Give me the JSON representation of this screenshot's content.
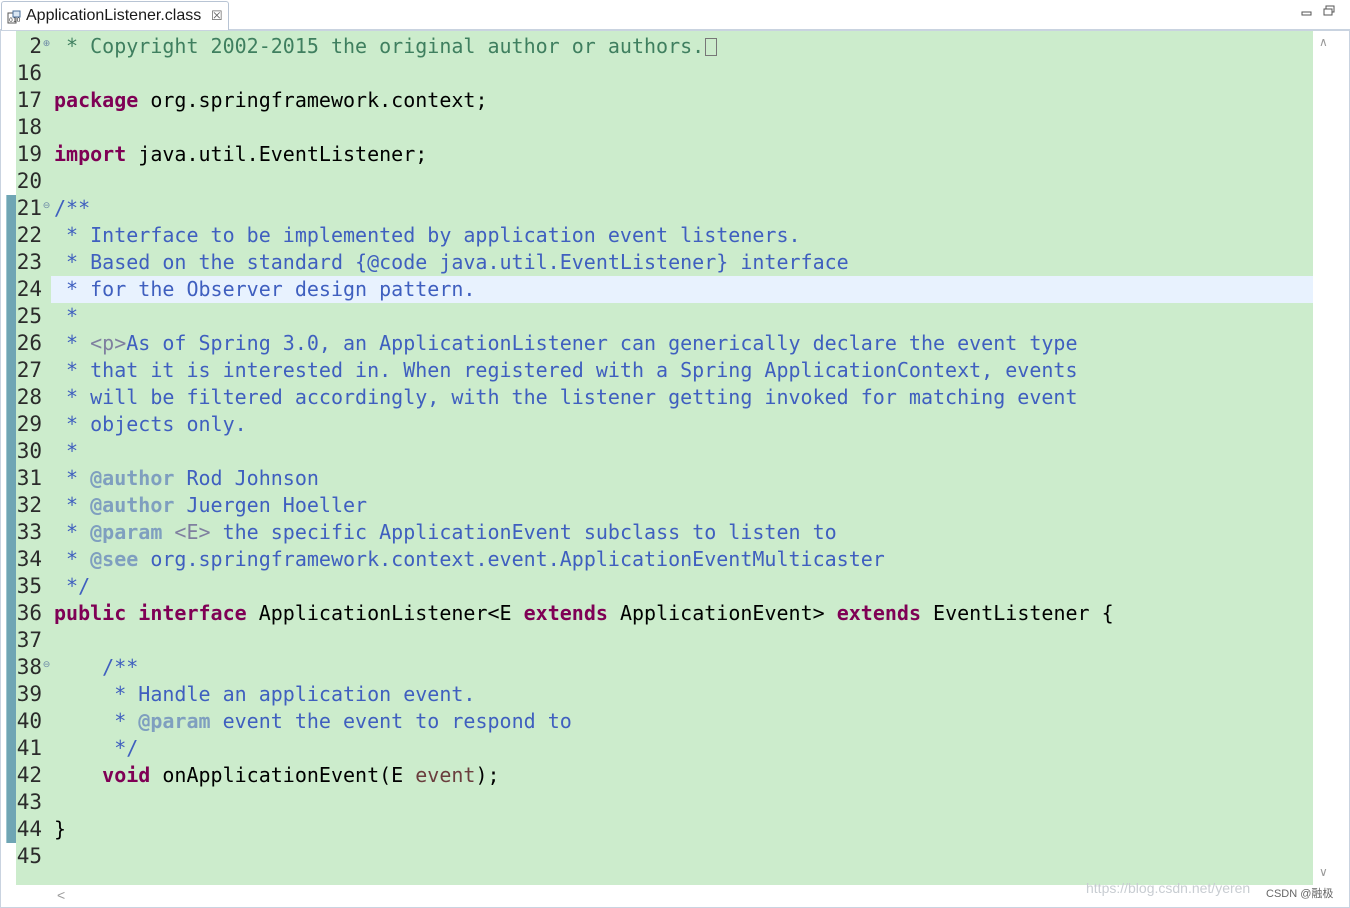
{
  "tab": {
    "title": "ApplicationListener.class",
    "icon": "class-file-icon",
    "close_glyph": "☒"
  },
  "window": {
    "minimize_icon": "minimize-icon",
    "maximize_icon": "maximize-icon"
  },
  "line_numbers": [
    "2",
    "16",
    "17",
    "18",
    "19",
    "20",
    "21",
    "22",
    "23",
    "24",
    "25",
    "26",
    "27",
    "28",
    "29",
    "30",
    "31",
    "32",
    "33",
    "34",
    "35",
    "36",
    "37",
    "38",
    "39",
    "40",
    "41",
    "42",
    "43",
    "44",
    "45"
  ],
  "code": {
    "l2_star": " * ",
    "l2_text": "Copyright 2002-2015 the original author or authors.",
    "l17_kw": "package",
    "l17_text": " org.springframework.context;",
    "l19_kw": "import",
    "l19_text": " java.util.EventListener;",
    "l21": "/**",
    "l22": " * Interface to be implemented by application event listeners.",
    "l23": " * Based on the standard {@code java.util.EventListener} interface",
    "l24": " * for the Observer design pattern.",
    "l25": " *",
    "l26_a": " * ",
    "l26_tag": "<p>",
    "l26_b": "As of Spring 3.0, an ApplicationListener can generically declare the event type",
    "l27": " * that it is interested in. When registered with a Spring ApplicationContext, events",
    "l28": " * will be filtered accordingly, with the listener getting invoked for matching event",
    "l29": " * objects only.",
    "l30": " *",
    "l31_a": " * ",
    "l31_tag": "@author",
    "l31_b": " Rod Johnson",
    "l32_a": " * ",
    "l32_tag": "@author",
    "l32_b": " Juergen Hoeller",
    "l33_a": " * ",
    "l33_tag": "@param",
    "l33_h": " <E>",
    "l33_b": " the specific ApplicationEvent subclass to listen to",
    "l34_a": " * ",
    "l34_tag": "@see",
    "l34_b": " org.springframework.context.event.ApplicationEventMulticaster",
    "l35": " */",
    "l36_kw1": "public",
    "l36_sp1": " ",
    "l36_kw2": "interface",
    "l36_t1": " ApplicationListener<E ",
    "l36_kw3": "extends",
    "l36_t2": " ApplicationEvent> ",
    "l36_kw4": "extends",
    "l36_t3": " EventListener {",
    "l38": "    /**",
    "l39": "     * Handle an application event.",
    "l40_a": "     * ",
    "l40_tag": "@param",
    "l40_b": " event the event to respond to",
    "l41": "     */",
    "l42_ind": "    ",
    "l42_kw": "void",
    "l42_t1": " onApplicationEvent(E ",
    "l42_var": "event",
    "l42_t2": ");",
    "l44": "}"
  },
  "folding": {
    "expand_glyph": "⊕",
    "collapse_glyph": "⊖"
  },
  "scrollbars": {
    "up": "∧",
    "down": "∨",
    "left": "<"
  },
  "watermark": "https://blog.csdn.net/yeren",
  "brand": "CSDN @融极",
  "colors": {
    "editor_bg": "#cceccc",
    "current_line": "#e8f2fe",
    "keyword": "#7f0055",
    "comment": "#3f7f5f",
    "javadoc": "#3f5fbf",
    "javadoc_tag": "#7f9fbf"
  }
}
